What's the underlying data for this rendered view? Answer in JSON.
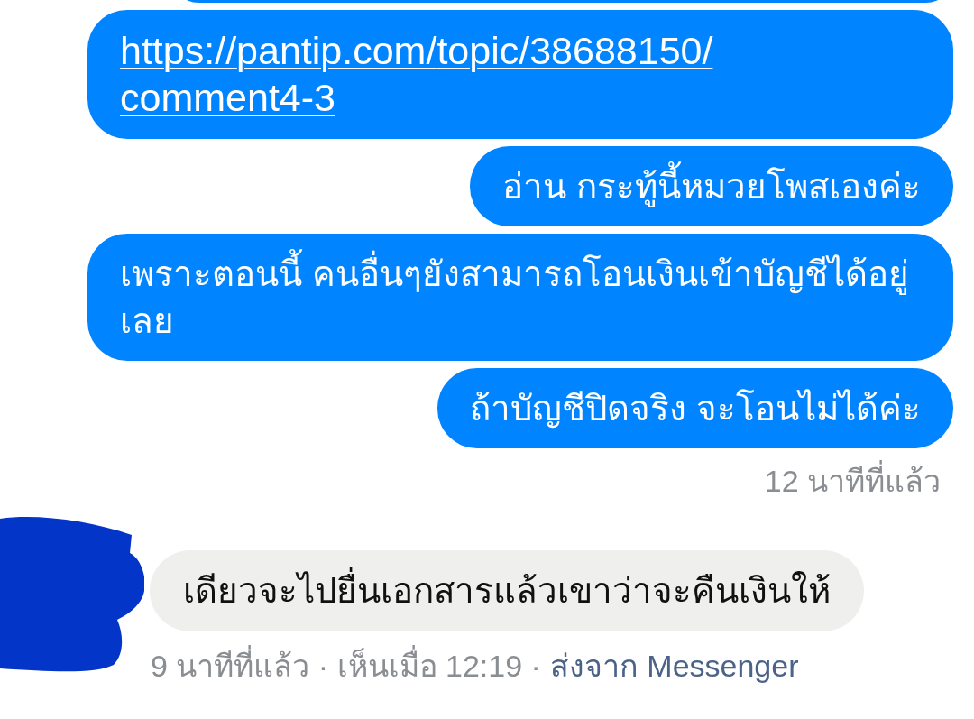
{
  "sent": {
    "messages": [
      {
        "kind": "cut_off"
      },
      {
        "kind": "link",
        "text": "https://pantip.com/topic/38688150/comment4-3"
      },
      {
        "kind": "text",
        "text": "อ่าน กระทู้นี้หมวยโพสเองค่ะ"
      },
      {
        "kind": "text",
        "text": "เพราะตอนนี้ คนอื่นๆยังสามารถโอนเงินเข้าบัญชีได้อยู่เลย"
      },
      {
        "kind": "text",
        "text": "ถ้าบัญชีปิดจริง จะโอนไม่ได้ค่ะ"
      }
    ],
    "time": "12 นาทีที่แล้ว"
  },
  "received": {
    "avatar_redacted": true,
    "messages": [
      {
        "kind": "text",
        "text": "เดียวจะไปยื่นเอกสารแล้วเขาว่าจะคืนเงินให้"
      }
    ],
    "receipt": "9 นาทีที่แล้ว · เห็นเมื่อ 12:19 ·",
    "source": "ส่งจาก Messenger"
  }
}
